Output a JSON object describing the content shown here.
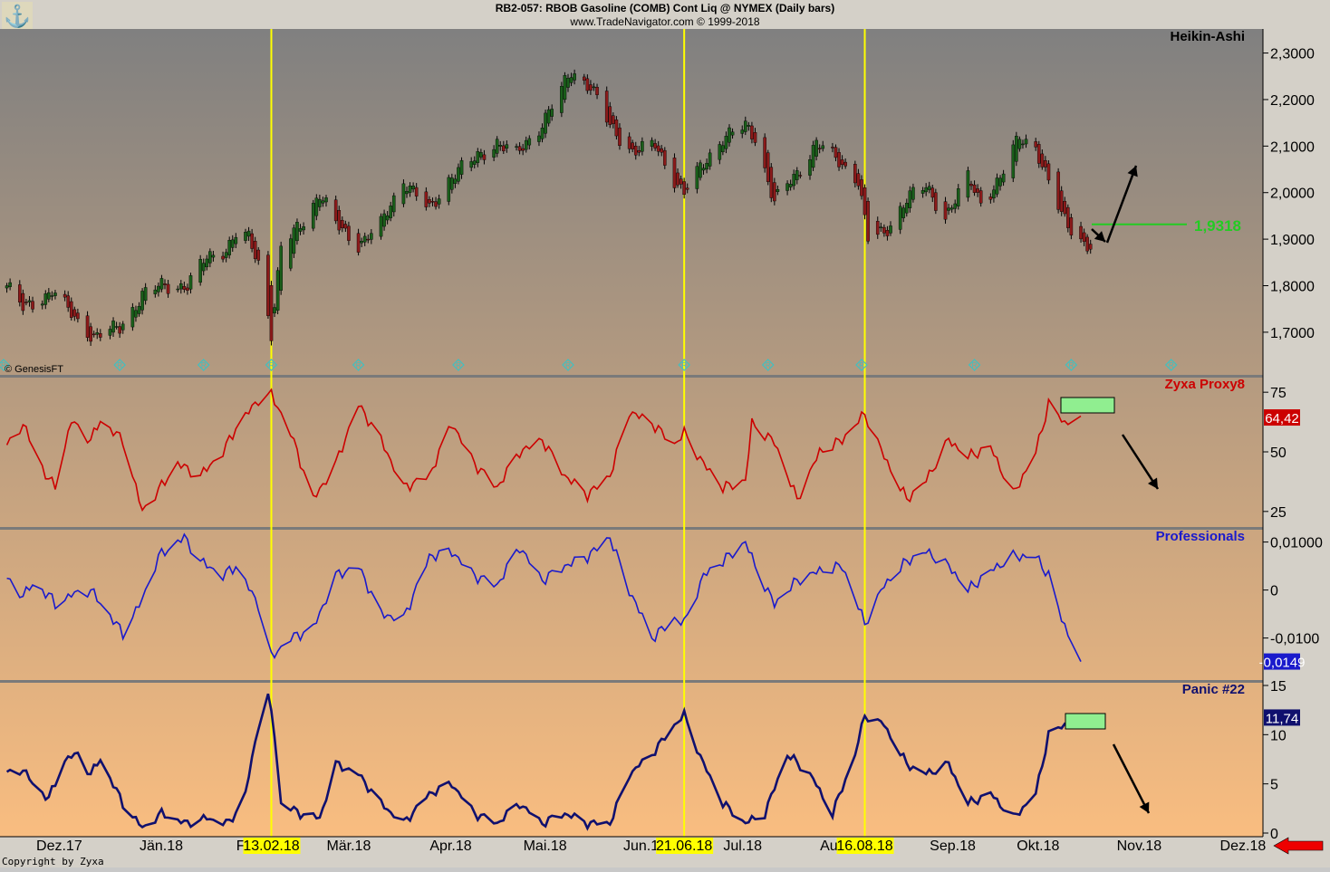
{
  "header": {
    "line1": "RB2-057:  RBOB Gasoline (COMB) Cont Liq @ NYMEX  (Daily bars)",
    "line2": "www.TradeNavigator.com © 1999-2018"
  },
  "copyright_small": "© GenesisFT",
  "footer_copyright": "Copyright by Zyxa",
  "colors": {
    "bg_top": "#808080",
    "bg_bottom": "#f9bd80",
    "separator": "#7a7a7a",
    "vline": "#ffff00",
    "date_highlight": "#ffff00",
    "up_candle": "#1a5e1a",
    "down_candle": "#8b1a1a",
    "proxy_line": "#cc0000",
    "professionals_line": "#1a1acc",
    "panic_line": "#10106e",
    "resistance_line": "#22cc22",
    "green_box": "#90ee90",
    "arrow": "#000000",
    "nav_arrow": "#ee0000",
    "marker": "#40c0c0"
  },
  "vertical_lines": [
    "13.02.18",
    "21.06.18",
    "16.08.18"
  ],
  "x_axis_labels": [
    "Dez.17",
    "Jän.18",
    "Feb.18",
    "Mär.18",
    "Apr.18",
    "Mai.18",
    "Jun.18",
    "Jul.18",
    "Aug.18",
    "Sep.18",
    "Okt.18",
    "Nov.18",
    "Dez.18"
  ],
  "highlighted_dates": [
    "13.02.18",
    "21.06.18",
    "16.08.18"
  ],
  "chart_data": [
    {
      "type": "candlestick",
      "title": "Heikin-Ashi",
      "ylim": [
        1.62,
        2.34
      ],
      "y_ticks": [
        "2,3000",
        "2,2000",
        "2,1000",
        "2,0000",
        "1,9000",
        "1,8000",
        "1,7000"
      ],
      "y_tick_values": [
        2.3,
        2.2,
        2.1,
        2.0,
        1.9,
        1.8,
        1.7
      ],
      "anchors": [
        [
          "2017-11-23",
          1.8
        ],
        [
          "2017-11-28",
          1.75
        ],
        [
          "2017-12-05",
          1.78
        ],
        [
          "2017-12-07",
          1.79
        ],
        [
          "2017-12-14",
          1.73
        ],
        [
          "2017-12-20",
          1.69
        ],
        [
          "2017-12-28",
          1.71
        ],
        [
          "2018-01-04",
          1.78
        ],
        [
          "2018-01-10",
          1.8
        ],
        [
          "2018-01-18",
          1.8
        ],
        [
          "2018-01-24",
          1.86
        ],
        [
          "2018-01-30",
          1.88
        ],
        [
          "2018-02-02",
          1.91
        ],
        [
          "2018-02-06",
          1.9
        ],
        [
          "2018-02-09",
          1.85
        ],
        [
          "2018-02-13",
          1.7
        ],
        [
          "2018-02-16",
          1.88
        ],
        [
          "2018-02-22",
          1.93
        ],
        [
          "2018-02-28",
          2.0
        ],
        [
          "2018-03-05",
          1.93
        ],
        [
          "2018-03-12",
          1.89
        ],
        [
          "2018-03-19",
          1.93
        ],
        [
          "2018-03-26",
          2.03
        ],
        [
          "2018-04-03",
          1.96
        ],
        [
          "2018-04-10",
          2.04
        ],
        [
          "2018-04-17",
          2.07
        ],
        [
          "2018-04-24",
          2.11
        ],
        [
          "2018-04-30",
          2.08
        ],
        [
          "2018-05-07",
          2.14
        ],
        [
          "2018-05-14",
          2.22
        ],
        [
          "2018-05-17",
          2.26
        ],
        [
          "2018-05-23",
          2.23
        ],
        [
          "2018-05-29",
          2.14
        ],
        [
          "2018-06-05",
          2.09
        ],
        [
          "2018-06-12",
          2.1
        ],
        [
          "2018-06-18",
          2.03
        ],
        [
          "2018-06-21",
          2.0
        ],
        [
          "2018-06-27",
          2.06
        ],
        [
          "2018-07-03",
          2.12
        ],
        [
          "2018-07-10",
          2.14
        ],
        [
          "2018-07-13",
          2.12
        ],
        [
          "2018-07-19",
          1.98
        ],
        [
          "2018-07-26",
          2.04
        ],
        [
          "2018-08-01",
          2.11
        ],
        [
          "2018-08-07",
          2.07
        ],
        [
          "2018-08-14",
          2.03
        ],
        [
          "2018-08-17",
          1.9
        ],
        [
          "2018-08-22",
          1.91
        ],
        [
          "2018-08-29",
          1.99
        ],
        [
          "2018-09-04",
          2.01
        ],
        [
          "2018-09-10",
          1.95
        ],
        [
          "2018-09-17",
          2.03
        ],
        [
          "2018-09-21",
          1.98
        ],
        [
          "2018-09-27",
          2.03
        ],
        [
          "2018-10-03",
          2.12
        ],
        [
          "2018-10-08",
          2.1
        ],
        [
          "2018-10-12",
          2.02
        ],
        [
          "2018-10-16",
          1.95
        ],
        [
          "2018-10-22",
          1.9
        ],
        [
          "2018-10-25",
          1.88
        ]
      ],
      "annotation_value": "1,9318",
      "annotation_level": 1.9318
    },
    {
      "type": "line",
      "title": "Zyxa Proxy8",
      "ylim": [
        20,
        80
      ],
      "y_ticks": [
        "75",
        "50",
        "25"
      ],
      "y_tick_values": [
        75,
        50,
        25
      ],
      "last_value": "64,42",
      "anchors": [
        [
          "2017-11-23",
          52
        ],
        [
          "2017-11-28",
          62
        ],
        [
          "2017-12-01",
          52
        ],
        [
          "2017-12-06",
          38
        ],
        [
          "2017-12-08",
          36
        ],
        [
          "2017-12-13",
          63
        ],
        [
          "2017-12-19",
          55
        ],
        [
          "2017-12-22",
          63
        ],
        [
          "2017-12-29",
          55
        ],
        [
          "2018-01-04",
          25
        ],
        [
          "2018-01-09",
          34
        ],
        [
          "2018-01-15",
          45
        ],
        [
          "2018-01-22",
          40
        ],
        [
          "2018-01-29",
          50
        ],
        [
          "2018-02-02",
          60
        ],
        [
          "2018-02-09",
          72
        ],
        [
          "2018-02-13",
          74
        ],
        [
          "2018-02-19",
          58
        ],
        [
          "2018-02-26",
          30
        ],
        [
          "2018-03-05",
          45
        ],
        [
          "2018-03-12",
          70
        ],
        [
          "2018-03-19",
          55
        ],
        [
          "2018-03-26",
          35
        ],
        [
          "2018-04-03",
          40
        ],
        [
          "2018-04-10",
          62
        ],
        [
          "2018-04-17",
          45
        ],
        [
          "2018-04-24",
          35
        ],
        [
          "2018-05-01",
          50
        ],
        [
          "2018-05-08",
          55
        ],
        [
          "2018-05-15",
          40
        ],
        [
          "2018-05-22",
          32
        ],
        [
          "2018-05-29",
          40
        ],
        [
          "2018-06-04",
          67
        ],
        [
          "2018-06-11",
          62
        ],
        [
          "2018-06-18",
          53
        ],
        [
          "2018-06-21",
          58
        ],
        [
          "2018-06-27",
          45
        ],
        [
          "2018-07-03",
          35
        ],
        [
          "2018-07-10",
          38
        ],
        [
          "2018-07-12",
          62
        ],
        [
          "2018-07-19",
          54
        ],
        [
          "2018-07-26",
          30
        ],
        [
          "2018-08-02",
          50
        ],
        [
          "2018-08-09",
          55
        ],
        [
          "2018-08-16",
          66
        ],
        [
          "2018-08-22",
          48
        ],
        [
          "2018-08-29",
          30
        ],
        [
          "2018-09-04",
          38
        ],
        [
          "2018-09-11",
          55
        ],
        [
          "2018-09-17",
          48
        ],
        [
          "2018-09-24",
          52
        ],
        [
          "2018-10-01",
          32
        ],
        [
          "2018-10-08",
          50
        ],
        [
          "2018-10-12",
          70
        ],
        [
          "2018-10-17",
          62
        ],
        [
          "2018-10-22",
          65
        ]
      ]
    },
    {
      "type": "line",
      "title": "Professionals",
      "ylim": [
        -0.018,
        0.012
      ],
      "y_ticks": [
        "0,01000",
        "0",
        "-0,0100"
      ],
      "y_tick_values": [
        0.01,
        0,
        -0.01
      ],
      "last_value": "-0,0149",
      "anchors": [
        [
          "2017-11-23",
          0.002
        ],
        [
          "2017-11-28",
          -0.001
        ],
        [
          "2017-12-01",
          0.001
        ],
        [
          "2017-12-06",
          -0.001
        ],
        [
          "2017-12-08",
          -0.003
        ],
        [
          "2017-12-13",
          -0.001
        ],
        [
          "2017-12-19",
          0.0
        ],
        [
          "2017-12-29",
          -0.009
        ],
        [
          "2018-01-04",
          -0.002
        ],
        [
          "2018-01-09",
          0.007
        ],
        [
          "2018-01-17",
          0.011
        ],
        [
          "2018-01-22",
          0.006
        ],
        [
          "2018-01-29",
          0.003
        ],
        [
          "2018-02-02",
          0.005
        ],
        [
          "2018-02-09",
          -0.003
        ],
        [
          "2018-02-13",
          -0.014
        ],
        [
          "2018-02-19",
          -0.01
        ],
        [
          "2018-02-26",
          -0.008
        ],
        [
          "2018-03-05",
          0.003
        ],
        [
          "2018-03-12",
          0.005
        ],
        [
          "2018-03-19",
          -0.005
        ],
        [
          "2018-03-26",
          -0.006
        ],
        [
          "2018-04-03",
          0.007
        ],
        [
          "2018-04-10",
          0.008
        ],
        [
          "2018-04-17",
          0.003
        ],
        [
          "2018-04-24",
          0.001
        ],
        [
          "2018-05-01",
          0.009
        ],
        [
          "2018-05-08",
          0.002
        ],
        [
          "2018-05-15",
          0.005
        ],
        [
          "2018-05-22",
          0.007
        ],
        [
          "2018-05-29",
          0.011
        ],
        [
          "2018-06-04",
          0.0
        ],
        [
          "2018-06-11",
          -0.01
        ],
        [
          "2018-06-18",
          -0.006
        ],
        [
          "2018-06-21",
          -0.007
        ],
        [
          "2018-06-27",
          0.003
        ],
        [
          "2018-07-03",
          0.006
        ],
        [
          "2018-07-10",
          0.01
        ],
        [
          "2018-07-13",
          0.005
        ],
        [
          "2018-07-19",
          -0.003
        ],
        [
          "2018-07-26",
          0.002
        ],
        [
          "2018-08-02",
          0.004
        ],
        [
          "2018-08-09",
          0.005
        ],
        [
          "2018-08-16",
          -0.007
        ],
        [
          "2018-08-22",
          0.001
        ],
        [
          "2018-08-29",
          0.006
        ],
        [
          "2018-09-04",
          0.008
        ],
        [
          "2018-09-11",
          0.005
        ],
        [
          "2018-09-17",
          0.0
        ],
        [
          "2018-09-24",
          0.004
        ],
        [
          "2018-10-01",
          0.007
        ],
        [
          "2018-10-08",
          0.007
        ],
        [
          "2018-10-12",
          0.003
        ],
        [
          "2018-10-16",
          -0.006
        ],
        [
          "2018-10-22",
          -0.0149
        ]
      ]
    },
    {
      "type": "line",
      "title": "Panic #22",
      "ylim": [
        0,
        15
      ],
      "y_ticks": [
        "15",
        "10",
        "5",
        "0"
      ],
      "y_tick_values": [
        15,
        10,
        5,
        0
      ],
      "last_value": "11,74",
      "anchors": [
        [
          "2017-11-23",
          6
        ],
        [
          "2017-11-28",
          6.5
        ],
        [
          "2017-12-01",
          5
        ],
        [
          "2017-12-06",
          3.5
        ],
        [
          "2017-12-11",
          7.5
        ],
        [
          "2017-12-15",
          8
        ],
        [
          "2017-12-19",
          6
        ],
        [
          "2017-12-22",
          7.5
        ],
        [
          "2017-12-29",
          3
        ],
        [
          "2018-01-04",
          0.5
        ],
        [
          "2018-01-10",
          2
        ],
        [
          "2018-01-17",
          1
        ],
        [
          "2018-01-24",
          1.5
        ],
        [
          "2018-01-31",
          1
        ],
        [
          "2018-02-05",
          4
        ],
        [
          "2018-02-09",
          11
        ],
        [
          "2018-02-12",
          14
        ],
        [
          "2018-02-14",
          10
        ],
        [
          "2018-02-16",
          3
        ],
        [
          "2018-02-22",
          2
        ],
        [
          "2018-02-28",
          1.5
        ],
        [
          "2018-03-05",
          7
        ],
        [
          "2018-03-12",
          6
        ],
        [
          "2018-03-19",
          3
        ],
        [
          "2018-03-26",
          1
        ],
        [
          "2018-04-03",
          4
        ],
        [
          "2018-04-10",
          5
        ],
        [
          "2018-04-17",
          2
        ],
        [
          "2018-04-24",
          1
        ],
        [
          "2018-05-01",
          3
        ],
        [
          "2018-05-08",
          1
        ],
        [
          "2018-05-15",
          2
        ],
        [
          "2018-05-22",
          1
        ],
        [
          "2018-05-29",
          1
        ],
        [
          "2018-06-04",
          6
        ],
        [
          "2018-06-11",
          8
        ],
        [
          "2018-06-18",
          11
        ],
        [
          "2018-06-21",
          12
        ],
        [
          "2018-06-27",
          7
        ],
        [
          "2018-07-03",
          3
        ],
        [
          "2018-07-10",
          1
        ],
        [
          "2018-07-16",
          2
        ],
        [
          "2018-07-23",
          8
        ],
        [
          "2018-07-30",
          6
        ],
        [
          "2018-08-06",
          2
        ],
        [
          "2018-08-13",
          8
        ],
        [
          "2018-08-16",
          12
        ],
        [
          "2018-08-22",
          11
        ],
        [
          "2018-08-29",
          7
        ],
        [
          "2018-09-04",
          6
        ],
        [
          "2018-09-11",
          7
        ],
        [
          "2018-09-17",
          3
        ],
        [
          "2018-09-24",
          4
        ],
        [
          "2018-10-01",
          1.5
        ],
        [
          "2018-10-08",
          4
        ],
        [
          "2018-10-12",
          10
        ],
        [
          "2018-10-17",
          11
        ],
        [
          "2018-10-22",
          11.74
        ]
      ]
    }
  ]
}
